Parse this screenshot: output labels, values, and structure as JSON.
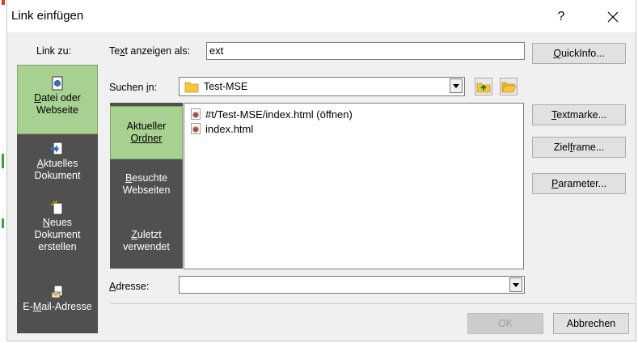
{
  "window": {
    "title": "Link einfügen",
    "help_label": "?",
    "close_label": "×"
  },
  "link_to": {
    "label": "Link zu:",
    "items": [
      {
        "label_line1": "Datei oder",
        "label_line2": "Webseite",
        "underline_char": "D",
        "icon": "web-file-icon",
        "active": true
      },
      {
        "label_line1": "Aktuelles",
        "label_line2": "Dokument",
        "underline_char": "A",
        "icon": "current-document-icon",
        "active": false
      },
      {
        "label_line1": "Neues",
        "label_line2": "Dokument",
        "label_line3": "erstellen",
        "underline_char": "N",
        "icon": "new-document-icon",
        "active": false
      },
      {
        "label_line1": "E-Mail-Adresse",
        "underline_char": "M",
        "icon": "email-address-icon",
        "active": false
      }
    ]
  },
  "display_text": {
    "label": "Text anzeigen als:",
    "value": "ext"
  },
  "quickinfo_button": "QuickInfo...",
  "look_in": {
    "label": "Suchen in:",
    "value": "Test-MSE"
  },
  "subnav": [
    {
      "line1": "Aktueller",
      "line2": "Ordner",
      "active": true
    },
    {
      "line1": "Besuchte",
      "line2": "Webseiten",
      "active": false
    },
    {
      "line1": "Zuletzt",
      "line2": "verwendet",
      "active": false
    }
  ],
  "files": [
    {
      "name": "#t/Test-MSE/index.html (öffnen)"
    },
    {
      "name": "index.html"
    }
  ],
  "side_buttons": {
    "bookmark": "Textmarke...",
    "target_frame": "Zielframe...",
    "parameters": "Parameter..."
  },
  "address": {
    "label": "Adresse:",
    "value": ""
  },
  "footer": {
    "ok": "OK",
    "cancel": "Abbrechen"
  },
  "colors": {
    "active_nav": "#a8d090",
    "nav_bg": "#505050",
    "dialog_bg": "#f0f0f0"
  }
}
